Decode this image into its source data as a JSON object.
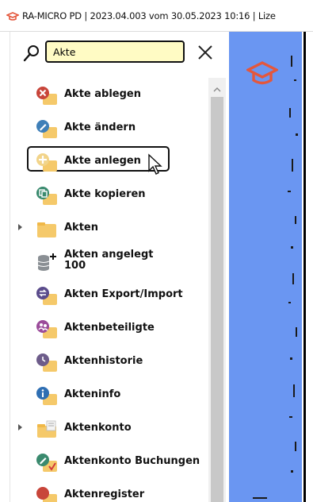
{
  "window": {
    "title": "RA-MICRO PD | 2023.04.003 vom 30.05.2023 10:16 | Lize"
  },
  "search": {
    "value": "Akte"
  },
  "icons": {
    "search": "search-icon",
    "close": "close-icon",
    "app_logo": "graduation-cap-icon"
  },
  "colors": {
    "accent": "#e4573c",
    "search_bg": "#fffbc4",
    "pane_blue": "#6a96f2"
  },
  "items": [
    {
      "label": "Akte ablegen",
      "icon": "akte-ablegen-icon",
      "expandable": false
    },
    {
      "label": "Akte ändern",
      "icon": "akte-aendern-icon",
      "expandable": false
    },
    {
      "label": "Akte anlegen",
      "icon": "akte-anlegen-icon",
      "expandable": false,
      "selected": true
    },
    {
      "label": "Akte kopieren",
      "icon": "akte-kopieren-icon",
      "expandable": false
    },
    {
      "label": "Akten",
      "icon": "folder-icon",
      "expandable": true
    },
    {
      "label": "Akten angelegt",
      "sublabel": "100",
      "icon": "database-icon",
      "expandable": false
    },
    {
      "label": "Akten Export/Import",
      "icon": "export-import-icon",
      "expandable": false
    },
    {
      "label": "Aktenbeteiligte",
      "icon": "beteiligte-icon",
      "expandable": false
    },
    {
      "label": "Aktenhistorie",
      "icon": "historie-icon",
      "expandable": false
    },
    {
      "label": "Akteninfo",
      "icon": "info-icon",
      "expandable": false
    },
    {
      "label": "Aktenkonto",
      "icon": "aktenkonto-icon",
      "expandable": true
    },
    {
      "label": "Aktenkonto Buchungen",
      "icon": "buchungen-icon",
      "expandable": false
    },
    {
      "label": "Aktenregister",
      "icon": "register-icon",
      "expandable": false
    }
  ]
}
